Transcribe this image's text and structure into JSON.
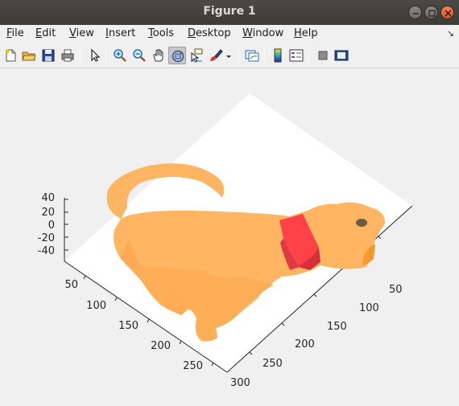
{
  "window": {
    "title": "Figure 1"
  },
  "menu": [
    "File",
    "Edit",
    "View",
    "Insert",
    "Tools",
    "Desktop",
    "Window",
    "Help"
  ],
  "menu_mnemonics": [
    "F",
    "E",
    "V",
    "I",
    "T",
    "D",
    "W",
    "H"
  ],
  "menu_rest": [
    "ile",
    "dit",
    "iew",
    "nsert",
    "ools",
    "esktop",
    "indow",
    "elp"
  ],
  "toolbar": {
    "buttons": [
      "new-figure",
      "open-file",
      "save",
      "print",
      "edit-plot",
      "zoom-in",
      "zoom-out",
      "pan",
      "rotate-3d",
      "data-cursor",
      "brush",
      "link-plot",
      "insert-colorbar",
      "insert-legend",
      "hide-plot-tools",
      "show-plot-tools"
    ],
    "pressed": "rotate-3d"
  },
  "axes": {
    "z_ticks": [
      "40",
      "20",
      "0",
      "-20",
      "-40"
    ],
    "x_ticks": [
      "50",
      "100",
      "150",
      "200",
      "250"
    ],
    "y_ticks": [
      "100",
      "150",
      "200",
      "250",
      "300"
    ],
    "y_tick_extra": "50"
  },
  "colors": {
    "body": "#ffb562",
    "collar": "#e0303a",
    "ear": "#f59a2a",
    "eye": "#6b5a45"
  }
}
